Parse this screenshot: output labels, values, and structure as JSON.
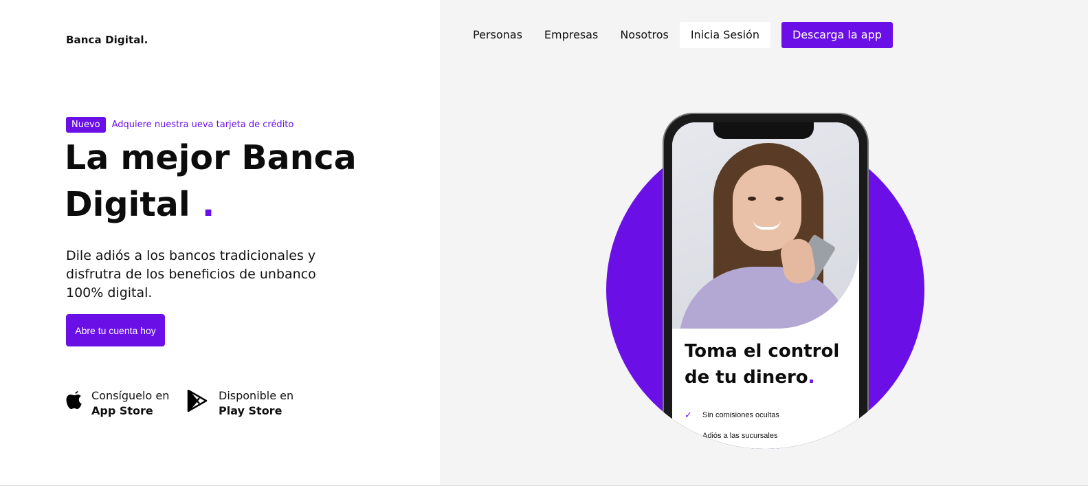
{
  "brand": {
    "name": "Banca Digital."
  },
  "nav": {
    "items": [
      "Personas",
      "Empresas",
      "Nosotros"
    ],
    "login": "Inicia Sesión",
    "download": "Descarga la app"
  },
  "hero": {
    "badge": "Nuevo",
    "badge_text": "Adquiere nuestra ueva tarjeta de crédito",
    "title_line1": "La mejor Banca",
    "title_line2": "Digital",
    "title_dot": ".",
    "description": "Dile adiós a los bancos tradicionales y disfrutra de los beneficios de unbanco 100% digital.",
    "cta": "Abre tu cuenta hoy"
  },
  "stores": {
    "apple": {
      "line1": "Consíguelo en",
      "line2": "App Store",
      "icon": "apple-icon"
    },
    "play": {
      "line1": "Disponible en",
      "line2": "Play Store",
      "icon": "play-store-icon"
    }
  },
  "phone": {
    "title_line1": "Toma el control",
    "title_line2": "de tu dinero",
    "title_dot": ".",
    "checks": [
      "Sin comisiones ocultas",
      "Adiós a las sucursales"
    ]
  },
  "colors": {
    "accent": "#6a0fe6",
    "right_background": "#f4f4f4"
  }
}
